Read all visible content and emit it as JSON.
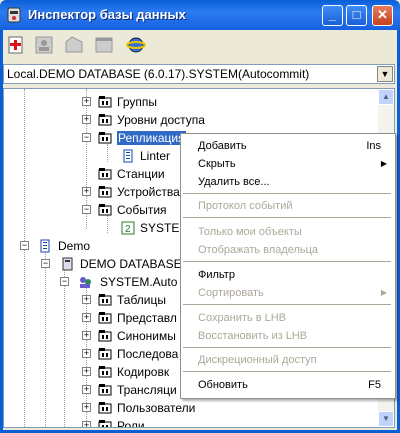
{
  "window": {
    "title": "Инспектор базы данных"
  },
  "toolbar": {
    "icons": [
      "add-icon",
      "user-icon",
      "folder-icon",
      "window-icon",
      "network-icon"
    ]
  },
  "connection": {
    "value": "Local.DEMO DATABASE (6.0.17).SYSTEM(Autocommit)"
  },
  "tree": {
    "groups": "Группы",
    "access_levels": "Уровни доступа",
    "replication": "Репликация",
    "linter": "Linter",
    "stations": "Станции",
    "devices": "Устройства",
    "events": "События",
    "system_event": "SYSTEM",
    "demo": "Demo",
    "demo_db": "DEMO DATABASE",
    "system_auto": "SYSTEM.Auto",
    "tables": "Таблицы",
    "views": "Представл",
    "synonyms": "Синонимы",
    "sequences": "Последова",
    "encodings": "Кодировк",
    "transliteration": "Трансляци",
    "users": "Пользователи",
    "roles": "Роли"
  },
  "menu": {
    "add": "Добавить",
    "add_key": "Ins",
    "hide": "Скрыть",
    "delete_all": "Удалить все...",
    "event_log": "Протокол событий",
    "only_mine": "Только мои объекты",
    "show_owner": "Отображать владельца",
    "filter": "Фильтр",
    "sort": "Сортировать",
    "save_lhb": "Сохранить в LHB",
    "restore_lhb": "Восстановить из LHB",
    "discretionary": "Дискреционный доступ",
    "refresh": "Обновить",
    "refresh_key": "F5"
  }
}
